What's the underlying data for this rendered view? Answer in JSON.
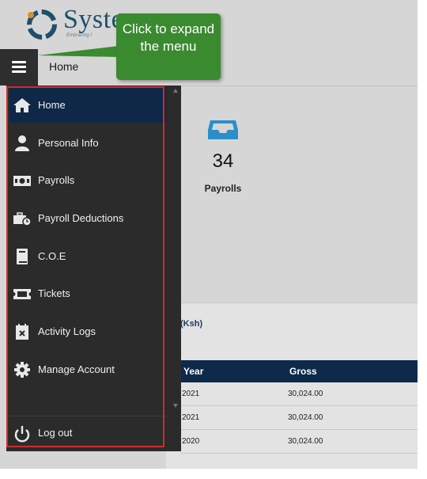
{
  "brand": {
    "name": "Syste",
    "tagline": "Embracing I"
  },
  "header": {
    "page_title": "Home",
    "menu_icon": "hamburger-icon"
  },
  "tooltip": {
    "text": "Click to expand the menu"
  },
  "stats_card": {
    "icon": "inbox-icon",
    "value": "34",
    "label": "Payrolls"
  },
  "panel": {
    "title": "(Ksh)",
    "columns": [
      "Year",
      "Gross"
    ],
    "rows": [
      {
        "year": "2021",
        "gross": "30,024.00"
      },
      {
        "year": "2021",
        "gross": "30,024.00"
      },
      {
        "year": "2020",
        "gross": "30,024.00"
      }
    ]
  },
  "sidebar": {
    "items": [
      {
        "label": "Home",
        "icon": "home-icon",
        "active": true
      },
      {
        "label": "Personal Info",
        "icon": "user-icon"
      },
      {
        "label": "Payrolls",
        "icon": "money-icon"
      },
      {
        "label": "Payroll Deductions",
        "icon": "briefcase-clock-icon"
      },
      {
        "label": "C.O.E",
        "icon": "book-icon"
      },
      {
        "label": "Tickets",
        "icon": "ticket-icon"
      },
      {
        "label": "Activity Logs",
        "icon": "calendar-x-icon"
      },
      {
        "label": "Manage Account",
        "icon": "gear-icon"
      }
    ],
    "logout": {
      "label": "Log out",
      "icon": "power-icon"
    }
  },
  "colors": {
    "sidebar_bg": "#2b2b2b",
    "active_item": "#0f2848",
    "tooltip_bg": "#3a8a2f",
    "highlight_border": "#d12b2b",
    "table_header": "#0e2a4a"
  }
}
